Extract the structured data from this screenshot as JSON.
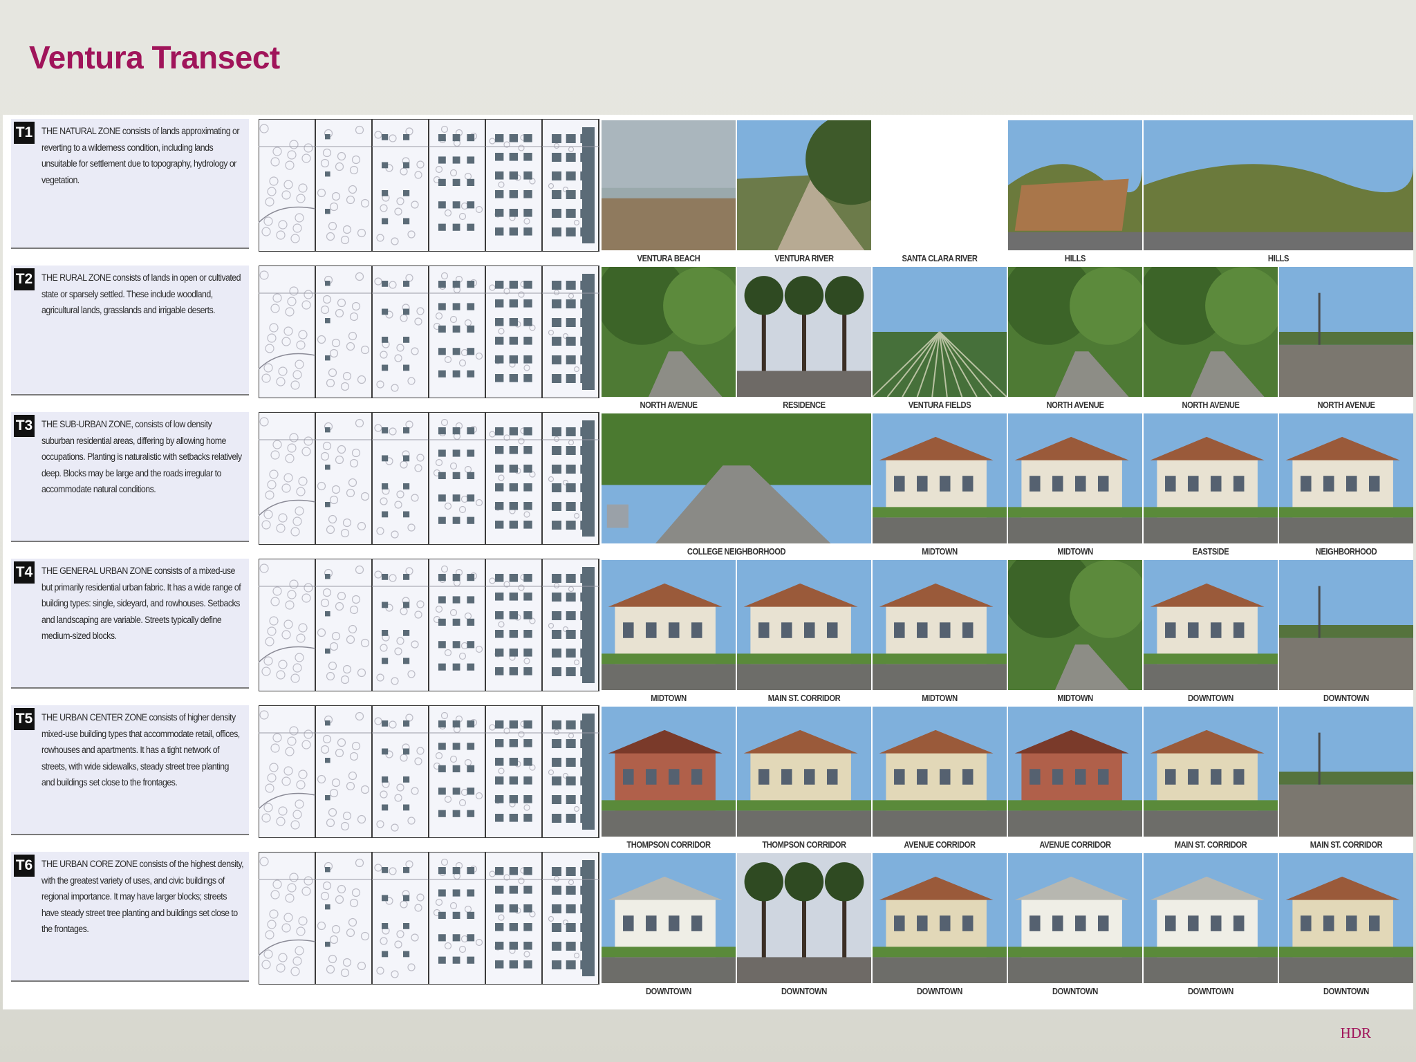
{
  "slide": {
    "title": "Ventura Transect",
    "credit": "HDR"
  },
  "zones": [
    {
      "tag": "T1",
      "text": "THE NATURAL ZONE consists of lands approximating or reverting to a wilderness condition, including lands unsuitable for settlement due to topography, hydrology or vegetation.",
      "photos": [
        {
          "caption": "VENTURA BEACH",
          "scene": "beach"
        },
        {
          "caption": "VENTURA RIVER",
          "scene": "river"
        },
        {
          "caption": "SANTA CLARA RIVER",
          "scene": "blank"
        },
        {
          "caption": "HILLS",
          "scene": "cliff"
        },
        {
          "caption": "HILLS",
          "scene": "hills",
          "wide": true
        }
      ]
    },
    {
      "tag": "T2",
      "text": "THE RURAL ZONE consists of lands in open or cultivated state or sparsely settled. These include woodland, agricultural lands, grasslands and irrigable deserts.",
      "photos": [
        {
          "caption": "NORTH AVENUE",
          "scene": "trees"
        },
        {
          "caption": "RESIDENCE",
          "scene": "palms"
        },
        {
          "caption": "VENTURA FIELDS",
          "scene": "fields"
        },
        {
          "caption": "NORTH AVENUE",
          "scene": "trees"
        },
        {
          "caption": "NORTH AVENUE",
          "scene": "trees"
        },
        {
          "caption": "NORTH AVENUE",
          "scene": "road"
        }
      ]
    },
    {
      "tag": "T3",
      "text": "THE SUB-URBAN ZONE, consists of low density suburban residential areas, differing by allowing home occupations. Planting is naturalistic with setbacks relatively deep. Blocks may be large and the roads irregular to accommodate natural conditions.",
      "photos": [
        {
          "caption": "COLLEGE NEIGHBORHOOD",
          "scene": "street",
          "wide": true
        },
        {
          "caption": "MIDTOWN",
          "scene": "house"
        },
        {
          "caption": "MIDTOWN",
          "scene": "house"
        },
        {
          "caption": "EASTSIDE",
          "scene": "house"
        },
        {
          "caption": "NEIGHBORHOOD",
          "scene": "house"
        }
      ]
    },
    {
      "tag": "T4",
      "text": "THE GENERAL URBAN ZONE consists of a mixed-use but primarily residential urban fabric. It has a wide range of building types: single, sideyard, and rowhouses. Setbacks and landscaping are variable. Streets typically define medium-sized blocks.",
      "photos": [
        {
          "caption": "MIDTOWN",
          "scene": "house"
        },
        {
          "caption": "MAIN ST. CORRIDOR",
          "scene": "house"
        },
        {
          "caption": "MIDTOWN",
          "scene": "house"
        },
        {
          "caption": "MIDTOWN",
          "scene": "trees"
        },
        {
          "caption": "DOWNTOWN",
          "scene": "house"
        },
        {
          "caption": "DOWNTOWN",
          "scene": "road"
        }
      ]
    },
    {
      "tag": "T5",
      "text": "THE URBAN CENTER ZONE consists of higher density mixed-use building types that accommodate retail, offices, rowhouses and apartments. It has a tight network of streets, with wide sidewalks, steady street tree planting and buildings set close to the frontages.",
      "photos": [
        {
          "caption": "THOMPSON CORRIDOR",
          "scene": "brick"
        },
        {
          "caption": "THOMPSON CORRIDOR",
          "scene": "building"
        },
        {
          "caption": "AVENUE CORRIDOR",
          "scene": "building"
        },
        {
          "caption": "AVENUE CORRIDOR",
          "scene": "brick"
        },
        {
          "caption": "MAIN ST. CORRIDOR",
          "scene": "building"
        },
        {
          "caption": "MAIN ST. CORRIDOR",
          "scene": "road"
        }
      ]
    },
    {
      "tag": "T6",
      "text": "THE URBAN CORE ZONE consists of the highest density, with the greatest variety of uses, and civic buildings of regional importance. It may have larger blocks; streets have steady street tree planting and buildings set close to the frontages.",
      "photos": [
        {
          "caption": "DOWNTOWN",
          "scene": "civic"
        },
        {
          "caption": "DOWNTOWN",
          "scene": "palms"
        },
        {
          "caption": "DOWNTOWN",
          "scene": "building"
        },
        {
          "caption": "DOWNTOWN",
          "scene": "mission"
        },
        {
          "caption": "DOWNTOWN",
          "scene": "civic"
        },
        {
          "caption": "DOWNTOWN",
          "scene": "building"
        }
      ]
    }
  ],
  "colors": {
    "title": "#a0145a",
    "credit": "#a0145a",
    "panel": "#eaebf6",
    "diagram_block": "#5b6b77"
  }
}
